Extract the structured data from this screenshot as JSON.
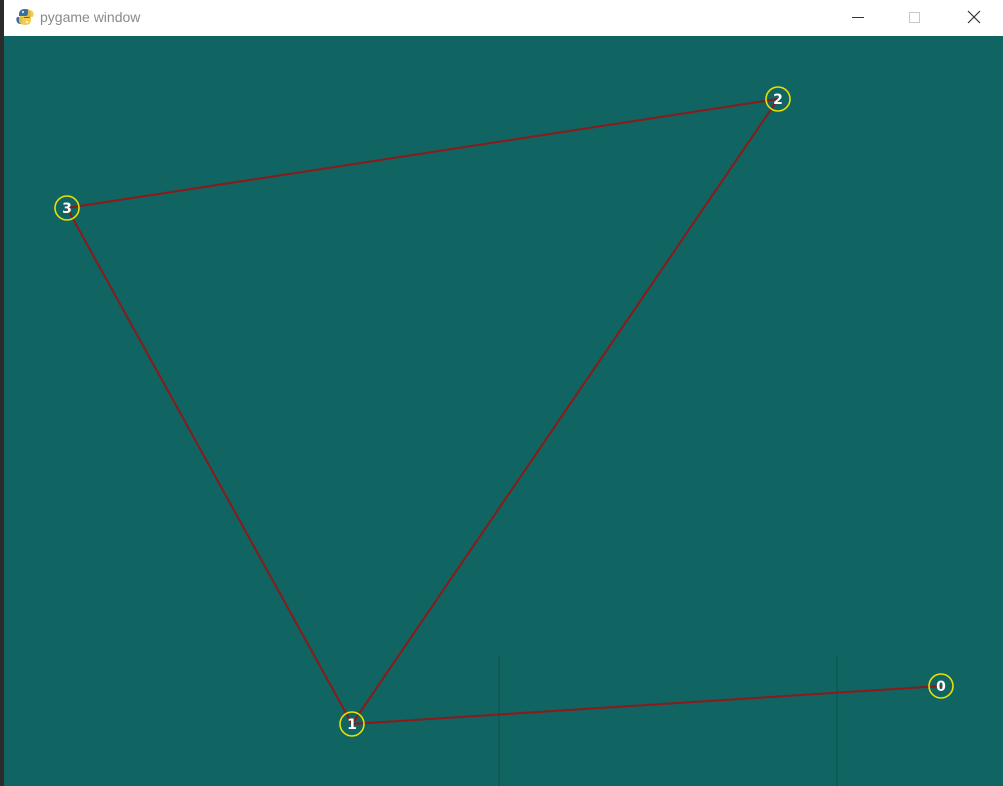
{
  "window": {
    "title": "pygame window",
    "app_icon": "pygame-snake-icon",
    "controls": {
      "minimize_icon": "minimize-icon",
      "maximize_icon": "maximize-icon",
      "close_icon": "close-icon"
    }
  },
  "canvas": {
    "background_color": "#106462",
    "edge_color": "#8b1a1a",
    "node_ring_color": "#e8e000",
    "node_label_color": "#ffffff",
    "nodes": [
      {
        "label": "0"
      },
      {
        "label": "1"
      },
      {
        "label": "2"
      },
      {
        "label": "3"
      }
    ],
    "edges": [
      {
        "from": "0",
        "to": "1"
      },
      {
        "from": "1",
        "to": "2"
      },
      {
        "from": "2",
        "to": "3"
      },
      {
        "from": "3",
        "to": "1"
      }
    ]
  }
}
